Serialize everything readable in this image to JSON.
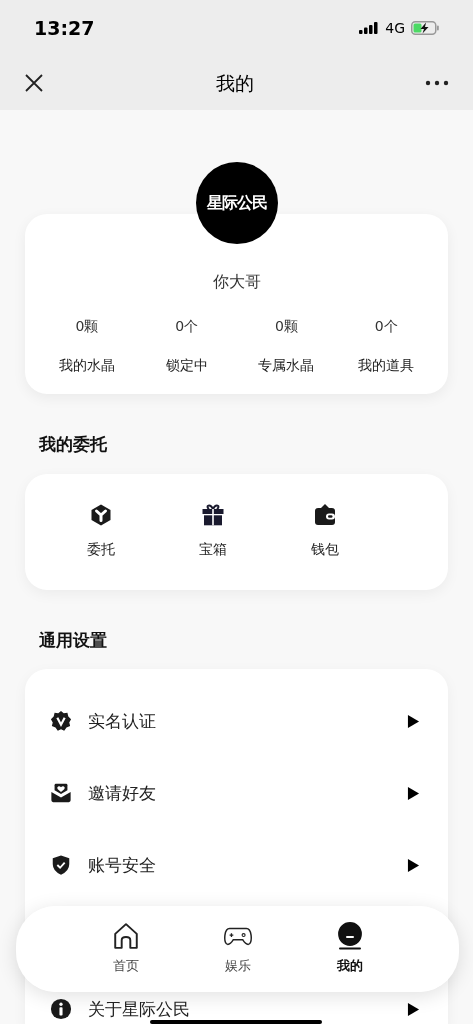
{
  "status_bar": {
    "time": "13:27",
    "network": "4G"
  },
  "nav_bar": {
    "title": "我的"
  },
  "profile": {
    "logo_text": "星际公民",
    "name": "你大哥",
    "stats": [
      {
        "value": "0颗",
        "label": "我的水晶"
      },
      {
        "value": "0个",
        "label": "锁定中"
      },
      {
        "value": "0颗",
        "label": "专属水晶"
      },
      {
        "value": "0个",
        "label": "我的道具"
      }
    ]
  },
  "commission": {
    "title": "我的委托",
    "items": [
      {
        "kind": "cube",
        "label": "委托"
      },
      {
        "kind": "gift",
        "label": "宝箱"
      },
      {
        "kind": "wallet",
        "label": "钱包"
      }
    ]
  },
  "settings": {
    "title": "通用设置",
    "items": [
      {
        "kind": "badge",
        "label": "实名认证"
      },
      {
        "kind": "mail",
        "label": "邀请好友"
      },
      {
        "kind": "shield",
        "label": "账号安全"
      },
      {
        "kind": "info",
        "label": "关于星际公民"
      }
    ]
  },
  "tab_bar": [
    {
      "kind": "home",
      "label": "首页",
      "selected": false
    },
    {
      "kind": "game",
      "label": "娱乐",
      "selected": false
    },
    {
      "kind": "me",
      "label": "我的",
      "selected": true
    }
  ]
}
